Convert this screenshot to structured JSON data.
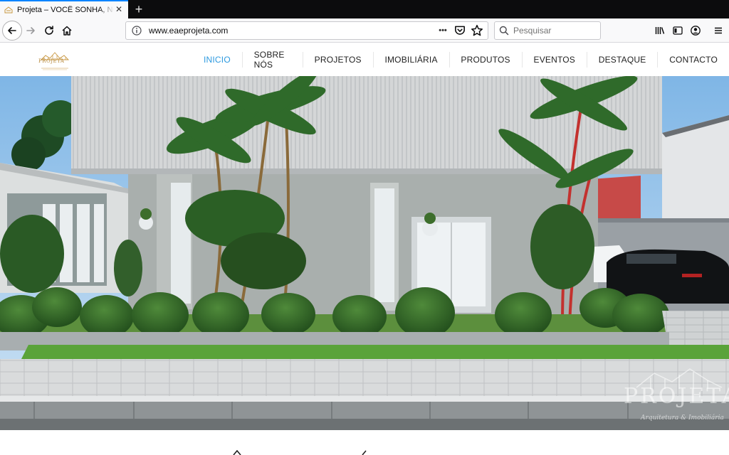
{
  "browser": {
    "tab": {
      "title": "Projeta – VOCÊ SONHA, NÓS PROJETAMOS",
      "close_glyph": "✕"
    },
    "newtab_glyph": "+",
    "url": "www.eaeprojeta.com",
    "url_more_glyph": "•••",
    "search_placeholder": "Pesquisar",
    "accent": "#0a84ff"
  },
  "site": {
    "logo_text": "PROJETA",
    "logo_color": "#b88a3e",
    "menu": [
      {
        "label": "INICIO",
        "active": true
      },
      {
        "label": "SOBRE NÓS"
      },
      {
        "label": "PROJETOS"
      },
      {
        "label": "IMOBILIÁRIA"
      },
      {
        "label": "PRODUTOS"
      },
      {
        "label": "EVENTOS"
      },
      {
        "label": "DESTAQUE"
      },
      {
        "label": "CONTACTO"
      }
    ],
    "active_color": "#2d9ae0"
  },
  "hero": {
    "watermark_name": "PROJETA",
    "watermark_sub": "Arquitetura & Imobiliária"
  }
}
